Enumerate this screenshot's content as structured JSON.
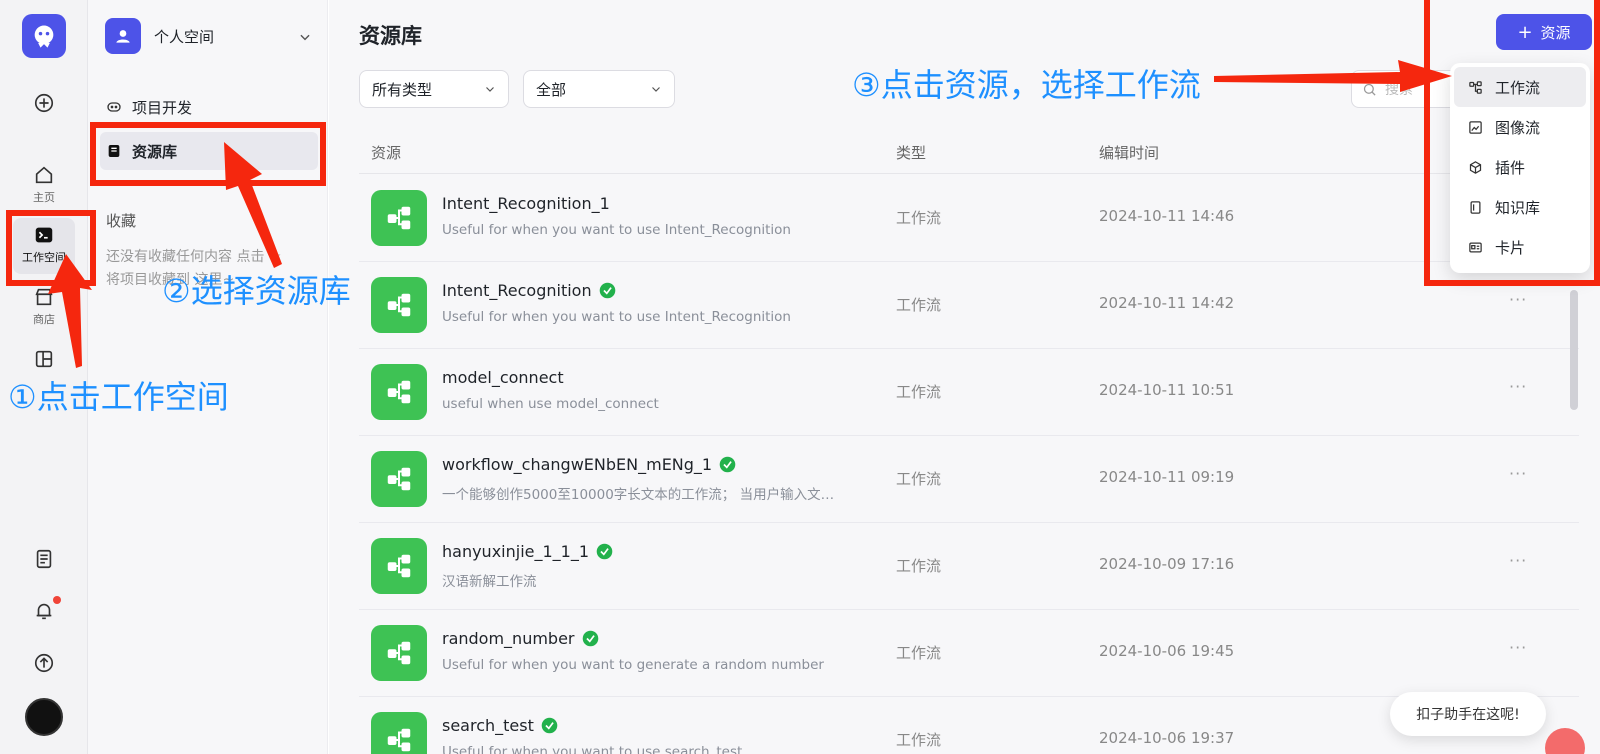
{
  "rail": {
    "items": [
      {
        "label": "主页",
        "icon": "home-icon"
      },
      {
        "label": "工作空间",
        "icon": "terminal-icon"
      },
      {
        "label": "商店",
        "icon": "store-icon"
      },
      {
        "label": "",
        "icon": "layout-icon"
      }
    ]
  },
  "sidebar": {
    "space_name": "个人空间",
    "items": [
      {
        "label": "项目开发",
        "icon": "gamepad-icon"
      },
      {
        "label": "资源库",
        "icon": "library-icon"
      }
    ],
    "favorites_title": "收藏",
    "favorites_empty": "还没有收藏任何内容 点击 ☆ 将项目收藏到 这里~"
  },
  "main": {
    "title": "资源库",
    "add_button": "资源",
    "filter_type": "所有类型",
    "filter_scope": "全部",
    "search_placeholder": "搜索",
    "columns": [
      "资源",
      "类型",
      "编辑时间"
    ],
    "rows": [
      {
        "name": "Intent_Recognition_1",
        "desc": "Useful for when you want to use Intent_Recognition",
        "type": "工作流",
        "time": "2024-10-11 14:46",
        "verified": false
      },
      {
        "name": "Intent_Recognition",
        "desc": "Useful for when you want to use Intent_Recognition",
        "type": "工作流",
        "time": "2024-10-11 14:42",
        "verified": true
      },
      {
        "name": "model_connect",
        "desc": "useful when use model_connect",
        "type": "工作流",
        "time": "2024-10-11 10:51",
        "verified": false
      },
      {
        "name": "workflow_changwENbEN_mENg_1",
        "desc": "一个能够创作5000至10000字长文本的工作流； 当用户输入文…",
        "type": "工作流",
        "time": "2024-10-11 09:19",
        "verified": true
      },
      {
        "name": "hanyuxinjie_1_1_1",
        "desc": "汉语新解工作流",
        "type": "工作流",
        "time": "2024-10-09 17:16",
        "verified": true
      },
      {
        "name": "random_number",
        "desc": "Useful for when you want to generate a random number",
        "type": "工作流",
        "time": "2024-10-06 19:45",
        "verified": true
      },
      {
        "name": "search_test",
        "desc": "Useful for when you want to use search_test",
        "type": "工作流",
        "time": "2024-10-06 19:37",
        "verified": true
      }
    ],
    "more": "···"
  },
  "menu": {
    "items": [
      {
        "label": "工作流",
        "icon": "workflow-icon"
      },
      {
        "label": "图像流",
        "icon": "image-flow-icon"
      },
      {
        "label": "插件",
        "icon": "cube-icon"
      },
      {
        "label": "知识库",
        "icon": "knowledge-icon"
      },
      {
        "label": "卡片",
        "icon": "card-icon"
      }
    ]
  },
  "helper": {
    "text": "扣子助手在这呢!"
  },
  "annotations": {
    "step1": "①点击工作空间",
    "step2": "②选择资源库",
    "step3": "③点击资源，选择工作流"
  },
  "colors": {
    "accent": "#4d53e8",
    "workflow_green": "#3ec254",
    "annotation_red": "#f5270e",
    "annotation_blue": "#1e90ff"
  }
}
